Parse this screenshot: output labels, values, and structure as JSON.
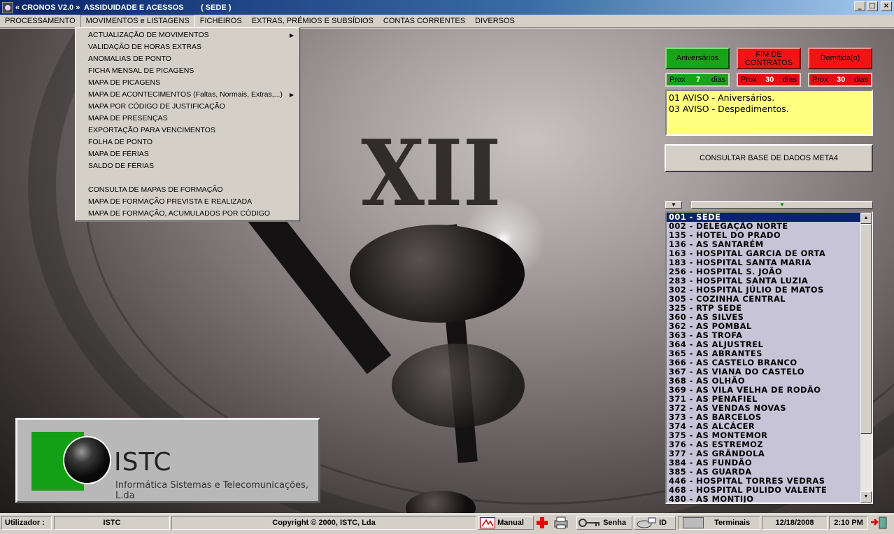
{
  "window": {
    "title": "« CRONOS V2.0 »  ASSIDUIDADE E ACESSOS        ( SEDE )",
    "minimize": "_",
    "maximize": "□",
    "close": "×"
  },
  "menubar": {
    "items": [
      "PROCESSAMENTO",
      "MOVIMENTOS e LISTAGENS",
      "FICHEIROS",
      "EXTRAS, PRÉMIOS E SUBSÍDIOS",
      "CONTAS CORRENTES",
      "DIVERSOS"
    ],
    "active_index": 1
  },
  "dropdown": {
    "items": [
      {
        "label": "ACTUALIZAÇÃO DE MOVIMENTOS",
        "submenu": true
      },
      {
        "label": "VALIDAÇÃO DE HORAS EXTRAS"
      },
      {
        "label": "ANOMALIAS DE PONTO"
      },
      {
        "label": "FICHA MENSAL DE PICAGENS"
      },
      {
        "label": "MAPA DE PICAGENS"
      },
      {
        "label": "MAPA DE ACONTECIMENTOS (Faltas, Normais, Extras,...)",
        "submenu": true
      },
      {
        "label": "MAPA POR CÓDIGO DE JUSTIFICAÇÃO"
      },
      {
        "label": "MAPA DE PRESENÇAS"
      },
      {
        "label": "EXPORTAÇÃO PARA VENCIMENTOS"
      },
      {
        "label": "FOLHA DE PONTO"
      },
      {
        "label": "MAPA DE FÉRIAS"
      },
      {
        "label": "SALDO DE FÉRIAS"
      },
      {
        "label": ""
      },
      {
        "label": "CONSULTA DE MAPAS DE FORMAÇÃO"
      },
      {
        "label": "MAPA DE FORMAÇÃO PREVISTA E REALIZADA"
      },
      {
        "label": "MAPA DE FORMAÇÃO, ACUMULADOS POR CÓDIGO"
      }
    ],
    "submenu_arrow": "▶"
  },
  "background": {
    "numeral": "XII"
  },
  "alerts": {
    "birthdays_label": "Aniversários",
    "contracts_label_1": "FIM DE",
    "contracts_label_2": "CONTRATOS",
    "dismissed_label": "Demitida(o)",
    "prox": "Prox",
    "dias": "dias",
    "birthdays_days": "7",
    "contracts_days": "30",
    "dismissed_days": "30",
    "colors": {
      "green": "#19a319",
      "red": "#f01414"
    }
  },
  "notice": {
    "lines": [
      "01  AVISO - Aniversários.",
      "03  AVISO - Despedimentos."
    ]
  },
  "consult_button": "CONSULTAR BASE DE DADOS  META4",
  "combo": {
    "small_arrow": "▼",
    "big_arrow": "▼"
  },
  "site_list": {
    "items": [
      "001 - SEDE",
      "002 - DELEGAÇÃO NORTE",
      "135 - HOTEL DO PRADO",
      "136 - AS SANTARÉM",
      "163 - HOSPITAL GARCIA DE ORTA",
      "183 - HOSPITAL SANTA MARIA",
      "256 - HOSPITAL S. JOÃO",
      "283 - HOSPITAL SANTA LUZIA",
      "302 - HOSPITAL JÚLIO DE MATOS",
      "305 - COZINHA CENTRAL",
      "325 - RTP SEDE",
      "360 - AS SILVES",
      "362 - AS POMBAL",
      "363 - AS TROFA",
      "364 - AS ALJUSTREL",
      "365 - AS ABRANTES",
      "366 - AS CASTELO BRANCO",
      "367 - AS VIANA DO CASTELO",
      "368 - AS OLHÃO",
      "369 - AS VILA VELHA DE RODÃO",
      "371 - AS PENAFIEL",
      "372 - AS VENDAS NOVAS",
      "373 - AS BARCELOS",
      "374 - AS ALCÁCER",
      "375 - AS MONTEMOR",
      "376 - AS ESTREMOZ",
      "377 - AS GRÂNDOLA",
      "384 - AS FUNDÃO",
      "385 - AS GUARDA",
      "446 - HOSPITAL TORRES VEDRAS",
      "468 - HOSPITAL PULIDO VALENTE",
      "480 - AS MONTIJO"
    ],
    "selected_index": 0,
    "scroll_up": "▲",
    "scroll_down": "▼"
  },
  "logo": {
    "brand": "ISTC",
    "subtitle": "Informática Sistemas e Telecomunicações, L.da"
  },
  "statusbar": {
    "user_label": "Utilizador :",
    "user_value": "ISTC",
    "copyright": "Copyright © 2000, ISTC, Lda",
    "manual": "Manual",
    "password": "Senha",
    "id": "ID",
    "terminals": "Terminais",
    "date": "12/18/2008",
    "time": "2:10 PM"
  }
}
